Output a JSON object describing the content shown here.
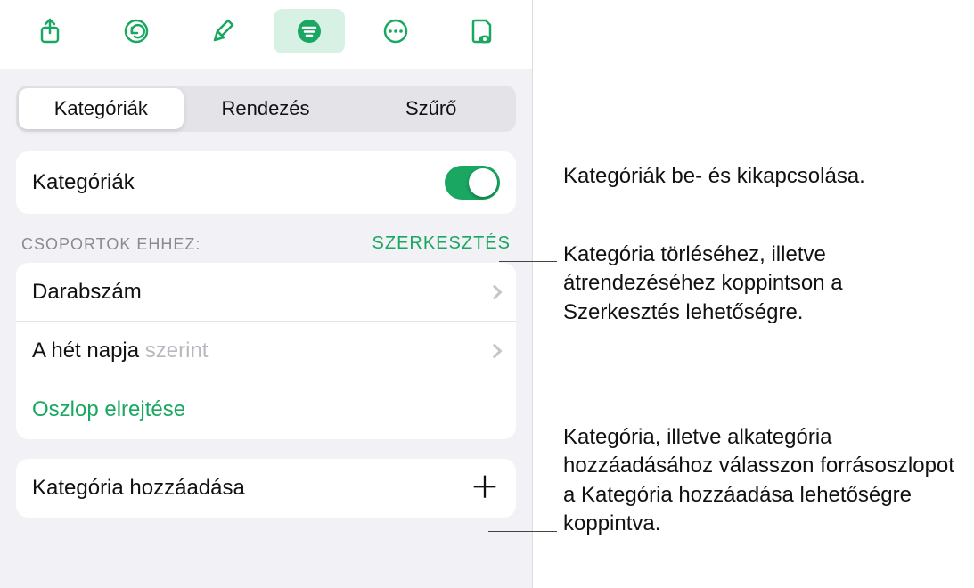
{
  "toolbar": {
    "icons": [
      "share",
      "undo",
      "format",
      "organize",
      "more",
      "preview"
    ]
  },
  "segmented": {
    "items": [
      "Kategóriák",
      "Rendezés",
      "Szűrő"
    ],
    "selected": 0
  },
  "toggle_row": {
    "label": "Kategóriák",
    "on": true
  },
  "groups_section": {
    "title": "CSOPORTOK EHHEZ:",
    "edit": "SZERKESZTÉS",
    "rows": [
      {
        "label": "Darabszám",
        "muted": ""
      },
      {
        "label": "A hét napja ",
        "muted": "szerint"
      }
    ],
    "hide_column": "Oszlop elrejtése"
  },
  "add_category": {
    "label": "Kategória hozzáadása"
  },
  "callouts": {
    "c1": "Kategóriák be- és kikapcsolása.",
    "c2": "Kategória törléséhez, illetve átrendezéséhez koppintson a Szerkesztés lehetőségre.",
    "c3": "Kategória, illetve alkategória hozzáadásához válasszon forrásoszlopot a Kategória hozzáadása lehetőségre koppintva."
  }
}
